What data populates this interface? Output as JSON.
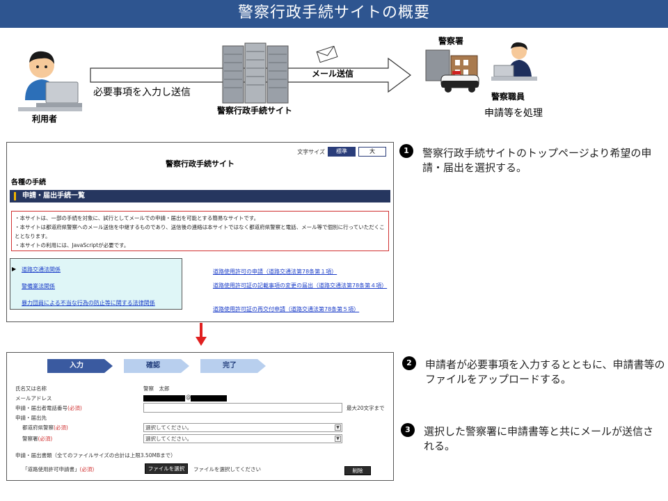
{
  "header": {
    "title": "警察行政手続サイトの概要"
  },
  "overview": {
    "user_label": "利用者",
    "input_label": "必要事項を入力し送信",
    "site_label": "警察行政手続サイト",
    "mail_label": "メール送信",
    "station_label": "警察署",
    "staff_label": "警察職員",
    "process_label": "申請等を処理"
  },
  "panel1": {
    "font_size_label": "文字サイズ",
    "font_standard": "標準",
    "font_large": "大",
    "site_title": "警察行政手続サイト",
    "section_title": "各種の手続",
    "band_title": "申請・届出手続一覧",
    "notices": [
      "・本サイトは、一部の手続を対象に、試行としてメールでの申請・届出を可能とする簡易なサイトです。",
      "・本サイトは都道府県警察へのメール送信を中継するものであり、送信後の連絡は本サイトではなく都道府県警察と電話、メール等で個別に行っていただくこととなります。",
      "・本サイトの利用には、JavaScriptが必要です。"
    ],
    "categories": [
      "道路交通法関係",
      "警備業法関係",
      "暴力団員による不当な行為の防止等に関する法律関係"
    ],
    "procedures": [
      "道路使用許可の申請（道路交通法第78条第１項）",
      "道路使用許可証の記載事項の変更の届出（道路交通法第78条第４項）",
      "道路使用許可証の再交付申請（道路交通法第78条第５項）"
    ]
  },
  "panel2": {
    "steps": [
      "入力",
      "確認",
      "完了"
    ],
    "fields": {
      "name_label": "氏名又は名称",
      "name_value": "警察　太郎",
      "email_label": "メールアドレス",
      "email_at": "@",
      "phone_label": "申請・届出者電話番号",
      "required": "(必須)",
      "phone_note": "最大20文字まで",
      "dest_label": "申請・届出先",
      "pref_label": "都道府県警察",
      "station_label": "警察署",
      "select_placeholder": "選択してください。",
      "docs_label": "申請・届出書類（全てのファイルサイズの合計は上限3.50MBまで）",
      "doc_name": "「道路使用許可申請書」",
      "file_button": "ファイルを選択",
      "file_placeholder": "ファイルを選択してください",
      "delete_button": "削除"
    }
  },
  "descriptions": [
    {
      "num": "1",
      "text": "警察行政手続サイトのトップページより希望の申請・届出を選択する。"
    },
    {
      "num": "2",
      "text": "申請者が必要事項を入力するとともに、申請書等のファイルをアップロードする。"
    },
    {
      "num": "3",
      "text": "選択した警察署に申請書等と共にメールが送信される。"
    }
  ],
  "colors": {
    "header": "#2e5590",
    "band": "#26365f",
    "step_active": "#3a5aa0",
    "step_inactive": "#b8cfee",
    "arrow_down": "#e02020",
    "notice_border": "#d03030"
  }
}
